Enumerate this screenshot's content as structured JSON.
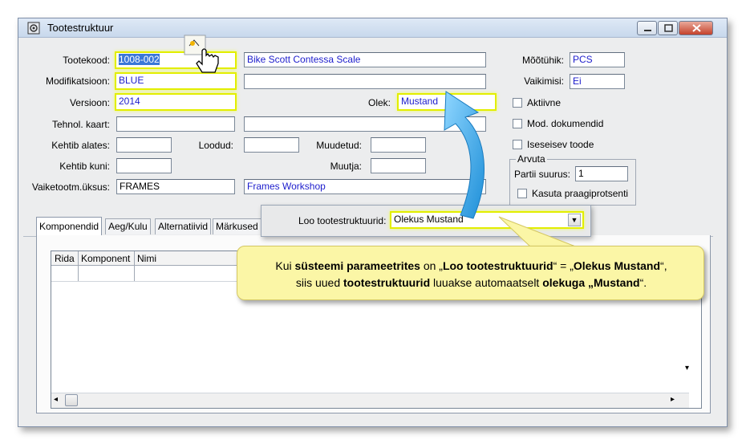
{
  "window": {
    "title": "Tootestruktuur"
  },
  "form": {
    "tootekood_label": "Tootekood:",
    "tootekood_value": "1008-002",
    "name_value": "Bike Scott Contessa Scale",
    "modifikatsioon_label": "Modifikatsioon:",
    "modifikatsioon_value": "BLUE",
    "versioon_label": "Versioon:",
    "versioon_value": "2014",
    "olek_label": "Olek:",
    "olek_value": "Mustand",
    "tehnol_label": "Tehnol. kaart:",
    "kehtib_alates_label": "Kehtib alates:",
    "loodud_label": "Loodud:",
    "muudetud_label": "Muudetud:",
    "kehtib_kuni_label": "Kehtib kuni:",
    "muutja_label": "Muutja:",
    "vaiketootm_label": "Vaiketootm.üksus:",
    "vaiketootm_value": "FRAMES",
    "workshop_value": "Frames Workshop",
    "mootuhik_label": "Mõõtühik:",
    "mootuhik_value": "PCS",
    "vaikimisi_label": "Vaikimisi:",
    "vaikimisi_value": "Ei",
    "aktiivne_label": "Aktiivne",
    "mod_dok_label": "Mod. dokumendid",
    "iseseisev_label": "Iseseisev toode",
    "arvuta_label": "Arvuta",
    "partii_label": "Partii suurus:",
    "partii_value": "1",
    "kasuta_label": "Kasuta praagiprotsenti"
  },
  "tabs": [
    "Komponendid",
    "Aeg/Kulu",
    "Alternatiivid",
    "Märkused"
  ],
  "table": {
    "headers": [
      "Rida",
      "Komponent",
      "Nimi"
    ]
  },
  "popup": {
    "label": "Loo tootestruktuurid:",
    "value": "Olekus Mustand"
  },
  "callout": {
    "t1": "Kui ",
    "b1": "süsteemi parameetrites",
    "t2": " on „",
    "b2": "Loo tootestruktuurid",
    "t3": "“ = „",
    "b3": "Olekus Mustand",
    "t4": "“,",
    "t5": "siis uued ",
    "b4": "tootestruktuurid",
    "t6": " luuakse automaatselt ",
    "b5": "olekuga „Mustand",
    "t7": "“."
  },
  "colors": {
    "highlight": "#e2ee00",
    "callout_bg": "#fbf6a6",
    "arrow": "#2aa6e8",
    "value_text": "#1c1ccc"
  },
  "icons": [
    "app-icon",
    "minimize-icon",
    "maximize-icon",
    "close-icon",
    "hand-cursor-icon",
    "new-record-icon",
    "dropdown-arrow-icon",
    "scroll-left-icon",
    "scroll-right-icon",
    "scroll-down-icon"
  ]
}
